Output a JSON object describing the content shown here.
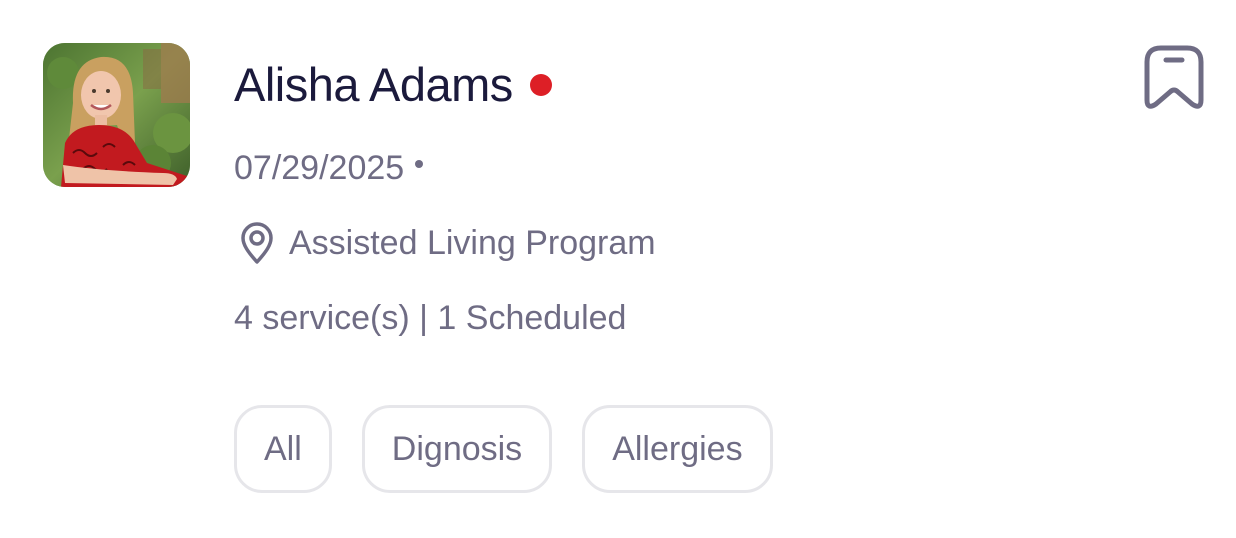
{
  "profile": {
    "name": "Alisha Adams",
    "status_color": "#dd1f26",
    "date": "07/29/2025",
    "location": "Assisted Living Program",
    "services_summary": "4 service(s) | 1 Scheduled",
    "avatar_icon": "profile-photo",
    "location_icon": "map-pin-icon",
    "bookmark_icon": "bookmark-icon"
  },
  "tabs": [
    {
      "label": "All"
    },
    {
      "label": "Dignosis"
    },
    {
      "label": "Allergies"
    }
  ],
  "colors": {
    "name_text": "#1b1a3c",
    "secondary_text": "#6f6c84",
    "chip_border": "#e6e6ea",
    "status": "#dd1f26"
  }
}
